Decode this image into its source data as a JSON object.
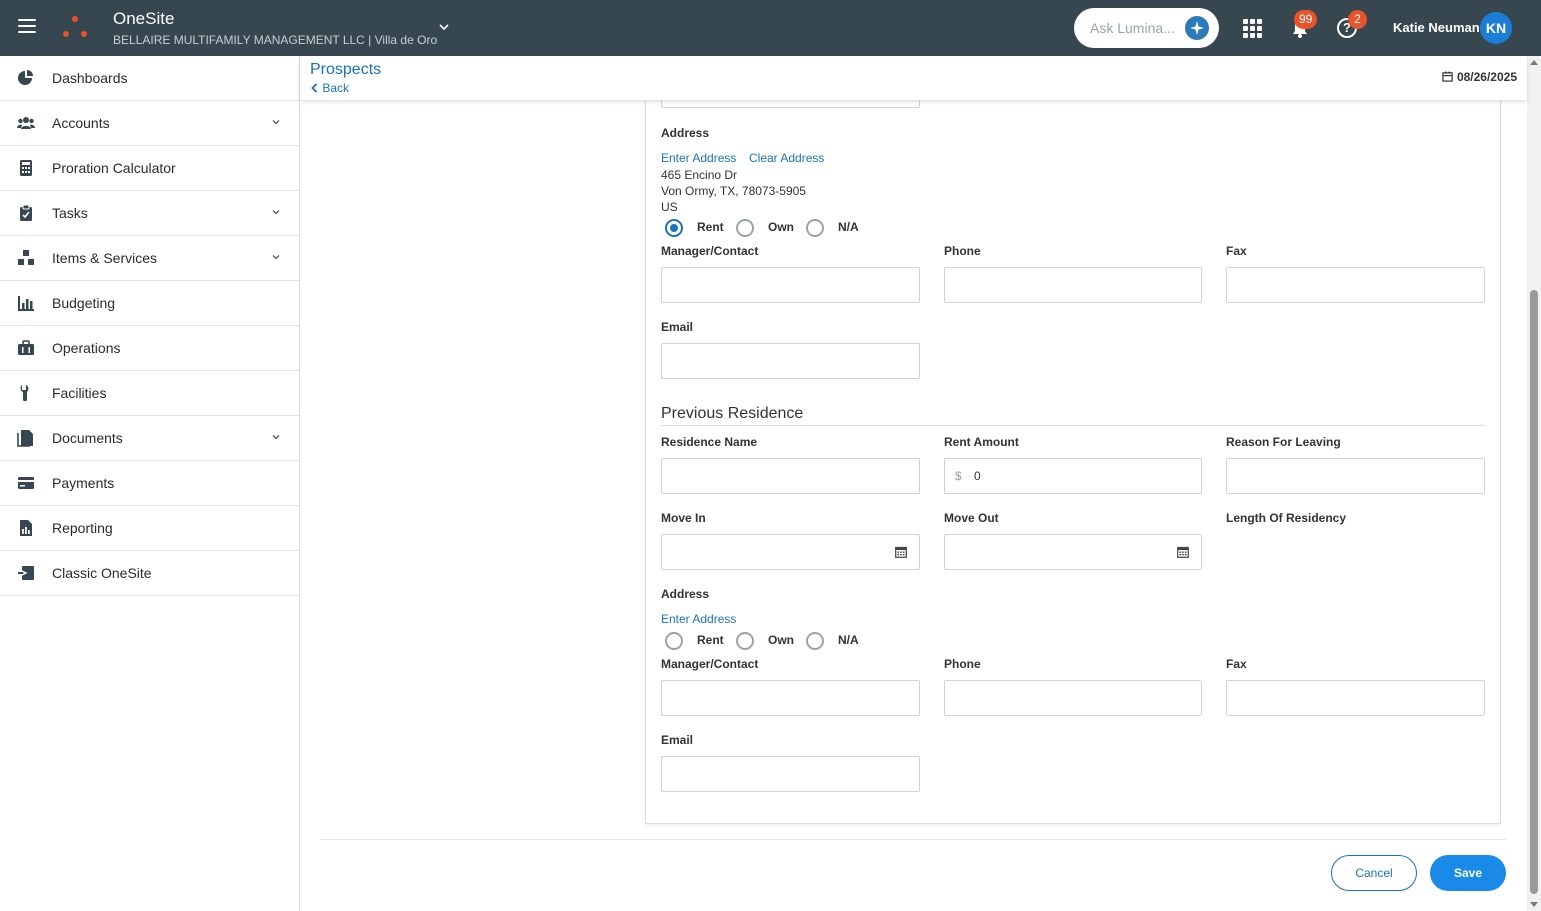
{
  "topbar": {
    "app_title": "OneSite",
    "property": "BELLAIRE MULTIFAMILY MANAGEMENT LLC | Villa de Oro",
    "ask_placeholder": "Ask Lumina...",
    "notifications_count": "99",
    "help_count": "2",
    "user_name": "Katie Neuman",
    "user_initials": "KN",
    "accent": "#e8532a"
  },
  "sidebar": {
    "items": [
      {
        "label": "Dashboards",
        "icon": "pie-chart-icon",
        "expandable": false
      },
      {
        "label": "Accounts",
        "icon": "users-icon",
        "expandable": true
      },
      {
        "label": "Proration Calculator",
        "icon": "calculator-icon",
        "expandable": false
      },
      {
        "label": "Tasks",
        "icon": "clipboard-check-icon",
        "expandable": true
      },
      {
        "label": "Items & Services",
        "icon": "boxes-icon",
        "expandable": true
      },
      {
        "label": "Budgeting",
        "icon": "bar-chart-icon",
        "expandable": false
      },
      {
        "label": "Operations",
        "icon": "briefcase-icon",
        "expandable": false
      },
      {
        "label": "Facilities",
        "icon": "wrench-icon",
        "expandable": false
      },
      {
        "label": "Documents",
        "icon": "document-icon",
        "expandable": true
      },
      {
        "label": "Payments",
        "icon": "credit-card-icon",
        "expandable": false
      },
      {
        "label": "Reporting",
        "icon": "report-icon",
        "expandable": false
      },
      {
        "label": "Classic OneSite",
        "icon": "exit-icon",
        "expandable": false
      }
    ]
  },
  "header": {
    "title": "Prospects",
    "back_label": "Back",
    "date": "08/26/2025"
  },
  "current": {
    "address_label": "Address",
    "enter_address": "Enter Address",
    "clear_address": "Clear Address",
    "address_lines": [
      "465 Encino Dr",
      "Von Ormy, TX, 78073-5905",
      "US"
    ],
    "radio_options": [
      "Rent",
      "Own",
      "N/A"
    ],
    "radio_selected": "Rent",
    "manager_label": "Manager/Contact",
    "phone_label": "Phone",
    "fax_label": "Fax",
    "email_label": "Email"
  },
  "previous": {
    "section_title": "Previous Residence",
    "residence_name_label": "Residence Name",
    "rent_amount_label": "Rent Amount",
    "rent_currency": "$",
    "rent_amount_value": "0",
    "reason_label": "Reason For Leaving",
    "move_in_label": "Move In",
    "move_out_label": "Move Out",
    "length_label": "Length Of Residency",
    "address_label": "Address",
    "enter_address": "Enter Address",
    "radio_options": [
      "Rent",
      "Own",
      "N/A"
    ],
    "radio_selected": "",
    "manager_label": "Manager/Contact",
    "phone_label": "Phone",
    "fax_label": "Fax",
    "email_label": "Email"
  },
  "footer": {
    "cancel_label": "Cancel",
    "save_label": "Save"
  }
}
